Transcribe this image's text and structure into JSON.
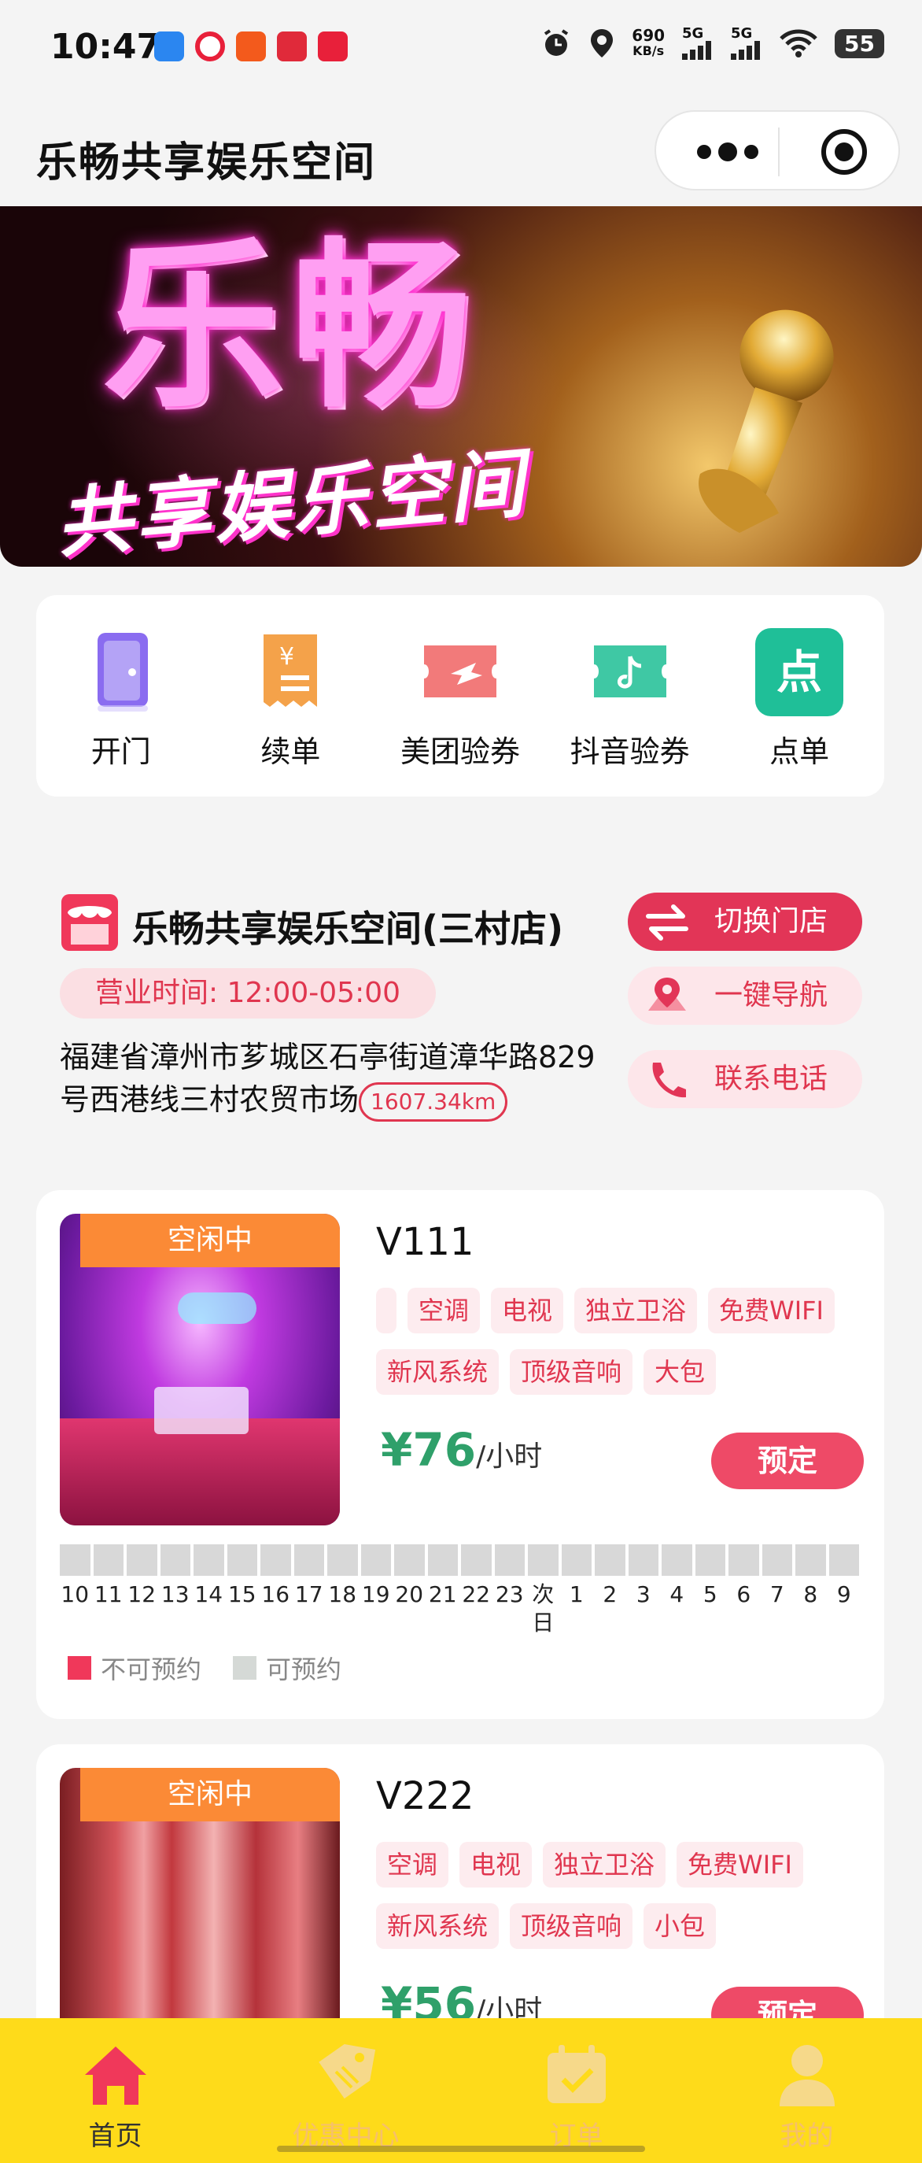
{
  "status_bar": {
    "time": "10:47",
    "speed_value": "690",
    "speed_unit": "KB/s",
    "signal_1": "5G",
    "signal_2": "5G",
    "battery": "55"
  },
  "nav": {
    "title": "乐畅共享娱乐空间"
  },
  "banner": {
    "headline": "乐畅",
    "subline": "共享娱乐空间"
  },
  "menu": {
    "items": [
      {
        "label": "开门",
        "icon": "door-icon",
        "color": "#8a6cf0"
      },
      {
        "label": "续单",
        "icon": "renew-icon",
        "color": "#f4a24a"
      },
      {
        "label": "美团验券",
        "icon": "meituan-ticket-icon",
        "color": "#f27a7a"
      },
      {
        "label": "抖音验券",
        "icon": "douyin-ticket-icon",
        "color": "#3fc8a4"
      },
      {
        "label": "点单",
        "icon": "order-icon",
        "color": "#1fbf98"
      }
    ]
  },
  "store": {
    "name": "乐畅共享娱乐空间(三村店)",
    "hours": "营业时间: 12:00-05:00",
    "address": "福建省漳州市芗城区石亭街道漳华路829号西港线三村农贸市场",
    "distance": "1607.34km",
    "switch_label": "切换门店",
    "nav_label": "一键导航",
    "phone_label": "联系电话"
  },
  "rooms": [
    {
      "status": "空闲中",
      "name": "V111",
      "tags": [
        "",
        "空调",
        "电视",
        "独立卫浴",
        "免费WIFI",
        "新风系统",
        "顶级音响",
        "大包"
      ],
      "price": "76",
      "currency": "¥",
      "unit": "/小时",
      "book_label": "预定"
    },
    {
      "status": "空闲中",
      "name": "V222",
      "tags": [
        "空调",
        "电视",
        "独立卫浴",
        "免费WIFI",
        "新风系统",
        "顶级音响",
        "小包"
      ],
      "price": "56",
      "currency": "¥",
      "unit": "/小时",
      "book_label": "预定"
    }
  ],
  "timeline": {
    "hours": [
      "10",
      "11",
      "12",
      "13",
      "14",
      "15",
      "16",
      "17",
      "18",
      "19",
      "20",
      "21",
      "22",
      "23",
      "次日",
      "1",
      "2",
      "3",
      "4",
      "5",
      "6",
      "7",
      "8",
      "9"
    ],
    "legend_unavailable": "不可预约",
    "legend_available": "可预约",
    "unavailable_color": "#f0385a",
    "available_color": "#d5d9d6"
  },
  "tabs": [
    {
      "label": "首页",
      "active": true
    },
    {
      "label": "优惠中心",
      "active": false
    },
    {
      "label": "订单",
      "active": false
    },
    {
      "label": "我的",
      "active": false
    }
  ]
}
